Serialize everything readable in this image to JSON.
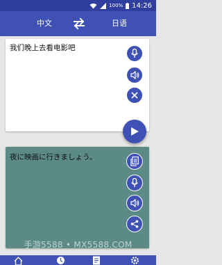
{
  "status_bar": {
    "battery_percent": "100%",
    "time": "14:26"
  },
  "toolbar": {
    "source_language": "中文",
    "target_language": "日语"
  },
  "input_card": {
    "text": "我们晚上去看电影吧"
  },
  "output_card": {
    "text": "夜に映画に行きましょう。"
  },
  "watermark": "手游5588 • MX5588.COM",
  "colors": {
    "primary": "#3f51b5",
    "primary_dark": "#303f9f",
    "output_background": "#5b8a87",
    "page_background": "#e6e6e6"
  },
  "icons": {
    "input_actions": [
      "microphone-icon",
      "speaker-icon",
      "close-icon"
    ],
    "translate": "send-icon",
    "output_actions": [
      "copy-icon",
      "microphone-icon",
      "speaker-icon",
      "share-icon"
    ],
    "bottom_nav": [
      "home-icon",
      "recent-icon",
      "notes-icon",
      "settings-icon"
    ]
  }
}
